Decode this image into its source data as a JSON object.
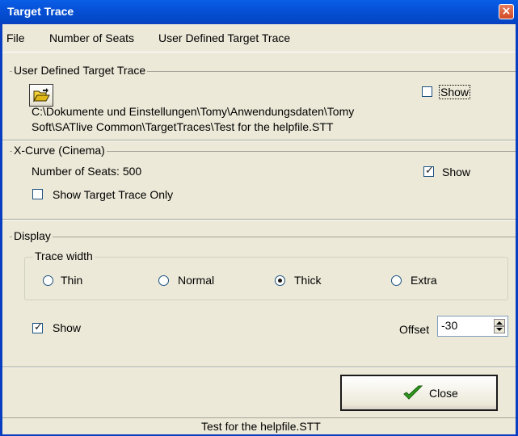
{
  "window": {
    "title": "Target Trace",
    "close_glyph": "×"
  },
  "menu": {
    "items": [
      "File",
      "Number of Seats",
      "User Defined Target Trace"
    ]
  },
  "user_trace": {
    "legend": "User Defined Target Trace",
    "show_label": "Show",
    "show_checked": false,
    "path_line1": "C:\\Dokumente und Einstellungen\\Tomy\\Anwendungsdaten\\Tomy",
    "path_line2": "Soft\\SATlive Common\\TargetTraces\\Test for the helpfile.STT",
    "open_icon": "open-folder-icon"
  },
  "xcurve": {
    "legend": "X-Curve (Cinema)",
    "seats_text": "Number of Seats: 500",
    "show_label": "Show",
    "show_checked": true,
    "target_only_label": "Show Target Trace Only",
    "target_only_checked": false
  },
  "display": {
    "legend": "Display",
    "trace_width_legend": "Trace width",
    "options": [
      "Thin",
      "Normal",
      "Thick",
      "Extra"
    ],
    "selected": "Thick",
    "show_label": "Show",
    "show_checked": true,
    "offset_label": "Offset",
    "offset_value": "-30"
  },
  "close_button": {
    "label": "Close",
    "icon": "checkmark-icon",
    "icon_color": "#2e9a1e"
  },
  "status": {
    "text": "Test for the helpfile.STT"
  },
  "colors": {
    "titlebar": "#0a5ee6",
    "window_bg": "#ece9d8"
  }
}
